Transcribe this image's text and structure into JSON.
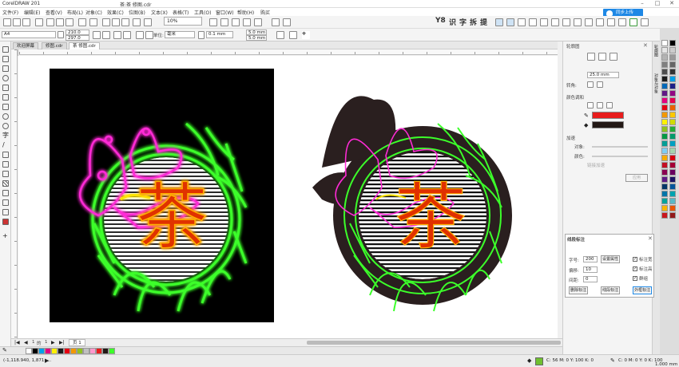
{
  "title_bar": {
    "app": "CorelDRAW 201",
    "document": "茶:茶 修图.cdr"
  },
  "menu": [
    "文件(F)",
    "编辑(E)",
    "查看(V)",
    "布局(L)",
    "对象(C)",
    "效果(C)",
    "位图(B)",
    "文本(X)",
    "表格(T)",
    "工具(O)",
    "窗口(W)",
    "帮助(H)",
    "购买"
  ],
  "cloud_button": "同步上传",
  "toolbar": {
    "zoom": "10%",
    "cjk_tools": [
      "Y8",
      "识",
      "字",
      "拆",
      "提"
    ]
  },
  "property_bar": {
    "page_size": "A4",
    "width": "210.0 mm",
    "height": "297.0 mm",
    "units_label": "单位:",
    "units": "毫米",
    "nudge": "0.1 mm",
    "dup_x": "5.0 mm",
    "dup_y": "5.0 mm"
  },
  "tabs": [
    "欢迎屏幕",
    "修图.cdr",
    "茶 修图.cdr"
  ],
  "docker": {
    "title": "轮廓图",
    "offset_value": "25.0 mm",
    "rotate_label": "转角:",
    "color_section": "颜色调和",
    "accel_section": "加速",
    "object_label": "对象:",
    "color_label": "颜色:",
    "link_label": "链接加速",
    "apply_button": "应用",
    "side_tabs": [
      "轮廓图",
      "对象与对象"
    ]
  },
  "annotation_dialog": {
    "title": "线段标注",
    "font_size_label": "字号:",
    "font_size": "200",
    "set_attr_button": "设置属性",
    "offset_label": "偏移:",
    "offset": "10",
    "spacing_label": "间距:",
    "spacing": "0",
    "checkboxes": [
      "标注宽",
      "标注高",
      "群组"
    ],
    "buttons": [
      "删除标注",
      "线段标注",
      "外框标注"
    ]
  },
  "page_nav": {
    "current": "1",
    "of_label": "的",
    "total": "1",
    "page_tab": "页 1"
  },
  "status": {
    "coords": "(-1,118.940, 1,871.....",
    "fill": "C: 56 M: 0 Y: 100 K: 0",
    "outline": "C: 0 M: 0 Y: 0 K: 100",
    "outline_width": "1.000 mm"
  },
  "artwork": {
    "character": "茶"
  },
  "colors": {
    "neon_green": "#3cff2a",
    "neon_magenta": "#ff2bd6",
    "neon_red": "#ff3a1a",
    "accent_blue": "#1e88e5"
  }
}
